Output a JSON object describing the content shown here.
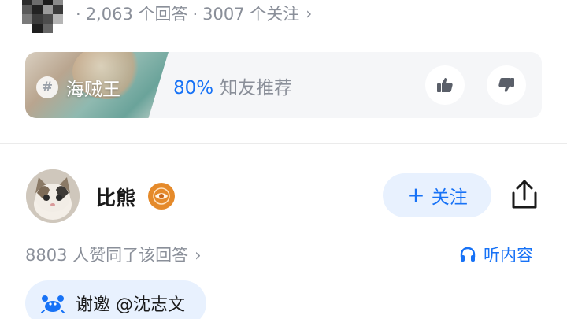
{
  "question_stats": {
    "answers": "2,063 个回答",
    "followers": "3007 个关注",
    "separator": "·",
    "chevron": "›"
  },
  "topic_card": {
    "topic_name": "海贼王",
    "hash_symbol": "#",
    "recommend_percent": "80%",
    "recommend_text": "知友推荐"
  },
  "author": {
    "name": "比熊",
    "follow_label": "关注",
    "follow_plus": "+"
  },
  "answer_meta": {
    "agree_text": "8803 人赞同了该回答",
    "chevron": "›",
    "listen_label": "听内容"
  },
  "invite": {
    "text": "谢邀 @沈志文"
  },
  "colors": {
    "accent": "#1772f6",
    "accent_bg": "#e8f1fe",
    "muted_text": "#8a8f99",
    "badge": "#e58a2a"
  }
}
